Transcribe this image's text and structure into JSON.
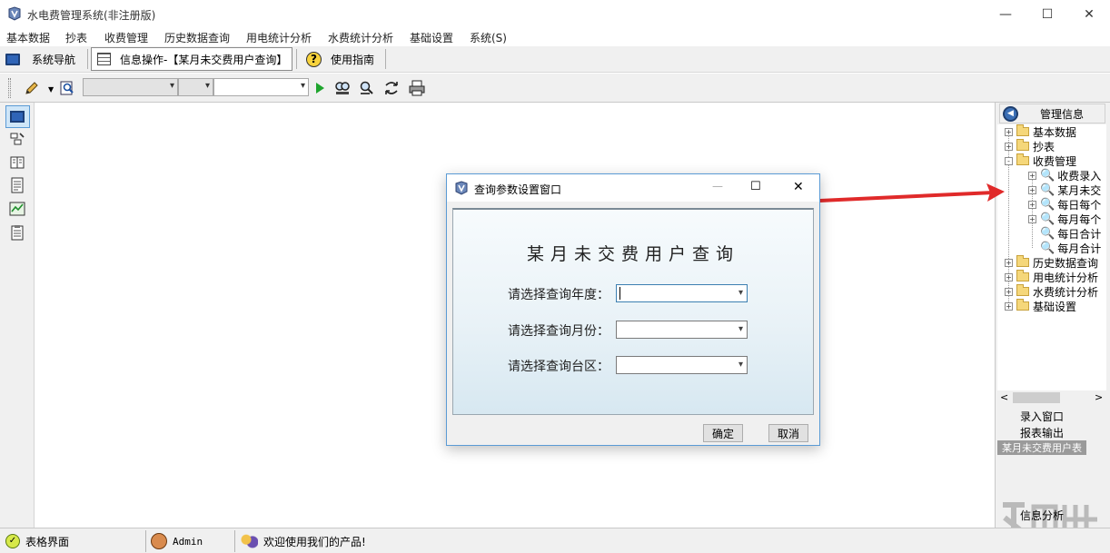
{
  "window": {
    "title": "水电费管理系统(非注册版)",
    "controls": {
      "minimize": "—",
      "maximize": "☐",
      "close": "✕"
    }
  },
  "menu": [
    "基本数据",
    "抄表",
    "收费管理",
    "历史数据查询",
    "用电统计分析",
    "水费统计分析",
    "基础设置",
    "系统(S)"
  ],
  "tabs": [
    {
      "label": "系统导航",
      "icon": "monitor-icon"
    },
    {
      "label": "信息操作-【某月未交费用户查询】",
      "icon": "grid-icon",
      "selected": true
    },
    {
      "label": "使用指南",
      "icon": "help-icon"
    }
  ],
  "toolbar": {
    "combo1_value": "",
    "combo2_value": "",
    "combo3_value": "",
    "icons": [
      "pencil-icon",
      "preview-icon",
      "run-icon",
      "find-icon",
      "find-next-icon",
      "replace-icon",
      "print-icon"
    ]
  },
  "right_panel": {
    "header": "管理信息",
    "tree": [
      {
        "label": "基本数据",
        "level": 0,
        "expander": "+"
      },
      {
        "label": "抄表",
        "level": 0,
        "expander": "+"
      },
      {
        "label": "收费管理",
        "level": 0,
        "expander": "-"
      },
      {
        "label": "收费录入",
        "level": 1,
        "expander": "+"
      },
      {
        "label": "某月未交",
        "level": 1,
        "expander": "+"
      },
      {
        "label": "每日每个",
        "level": 1,
        "expander": "+"
      },
      {
        "label": "每月每个",
        "level": 1,
        "expander": "+"
      },
      {
        "label": "每日合计",
        "level": 1,
        "expander": ""
      },
      {
        "label": "每月合计",
        "level": 1,
        "expander": ""
      },
      {
        "label": "历史数据查询",
        "level": 0,
        "expander": "+"
      },
      {
        "label": "用电统计分析",
        "level": 0,
        "expander": "+"
      },
      {
        "label": "水费统计分析",
        "level": 0,
        "expander": "+"
      },
      {
        "label": "基础设置",
        "level": 0,
        "expander": "+"
      }
    ],
    "tabs": [
      "录入窗口",
      "报表输出",
      "某月未交费用户表"
    ],
    "bottom_tab": "信息分析"
  },
  "dialog": {
    "title": "查询参数设置窗口",
    "heading": "某月未交费用户查询",
    "fields": [
      {
        "label": "请选择查询年度：",
        "value": ""
      },
      {
        "label": "请选择查询月份：",
        "value": ""
      },
      {
        "label": "请选择查询台区：",
        "value": ""
      }
    ],
    "ok": "确定",
    "cancel": "取消"
  },
  "status": {
    "view": "表格界面",
    "user": "Admin",
    "welcome": "欢迎使用我们的产品!"
  },
  "colors": {
    "accent": "#5b9bd5",
    "selection": "#d9e9f7",
    "arrow": "#e02a2a",
    "run": "#1fa52e"
  }
}
